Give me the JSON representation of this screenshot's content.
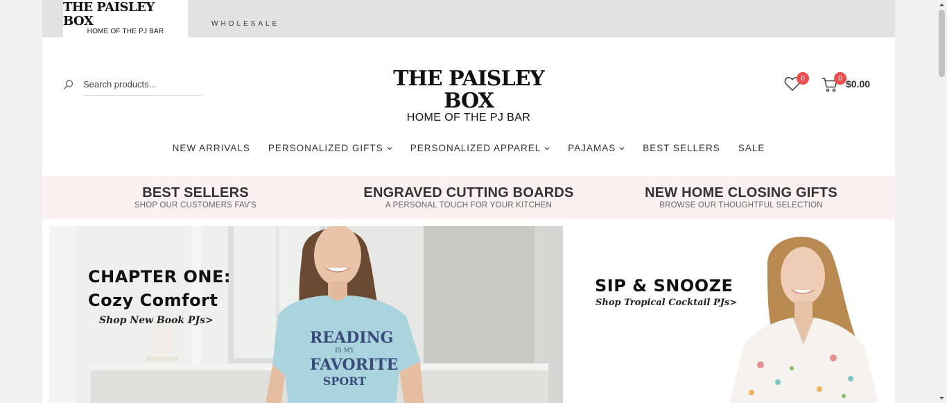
{
  "topbar": {
    "brand_line1": "THE PAISLEY BOX",
    "brand_line2": "HOME OF THE PJ BAR",
    "wholesale": "WHOLESALE"
  },
  "header": {
    "search_placeholder": "Search products...",
    "logo_line1": "THE PAISLEY BOX",
    "logo_line2": "HOME OF THE PJ BAR",
    "wishlist_count": "0",
    "cart_count": "0",
    "cart_total": "$0.00",
    "icons": [
      "search-icon",
      "heart-icon",
      "cart-icon"
    ],
    "badge_color": "#e94f4f"
  },
  "nav": {
    "items": [
      {
        "label": "NEW ARRIVALS",
        "dropdown": false
      },
      {
        "label": "PERSONALIZED GIFTS",
        "dropdown": true
      },
      {
        "label": "PERSONALIZED APPAREL",
        "dropdown": true
      },
      {
        "label": "PAJAMAS",
        "dropdown": true
      },
      {
        "label": "BEST SELLERS",
        "dropdown": false
      },
      {
        "label": "SALE",
        "dropdown": false
      }
    ]
  },
  "promo": {
    "background": "#fcf1f0",
    "items": [
      {
        "title": "BEST SELLERS",
        "subtitle": "SHOP OUR CUSTOMERS FAV'S"
      },
      {
        "title": "ENGRAVED CUTTING BOARDS",
        "subtitle": "A PERSONAL TOUCH FOR YOUR KITCHEN"
      },
      {
        "title": "NEW HOME CLOSING GIFTS",
        "subtitle": "BROWSE OUR THOUGHTFUL SELECTION"
      }
    ]
  },
  "banners": {
    "left": {
      "line1": "CHAPTER ONE:",
      "line2": "Cozy Comfort",
      "cta": "Shop New Book PJs>",
      "shirt_line1": "READING",
      "shirt_line2": "IS MY",
      "shirt_line3": "FAVORITE",
      "shirt_line4": "SPORT"
    },
    "right": {
      "line1": "SIP & SNOOZE",
      "cta": "Shop Tropical Cocktail PJs>"
    }
  }
}
